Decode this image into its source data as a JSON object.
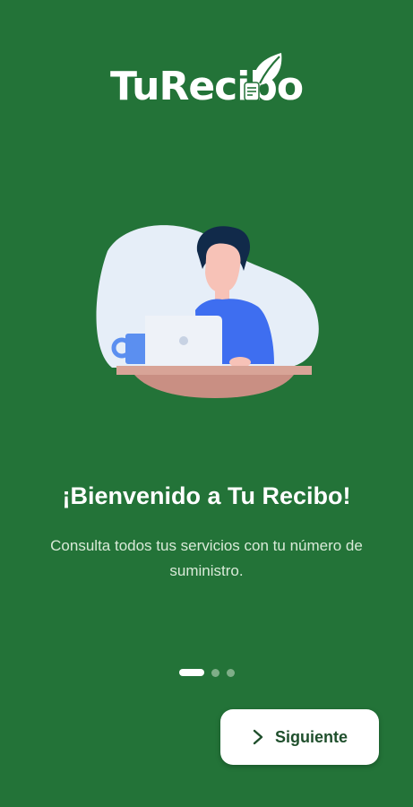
{
  "app": {
    "logo_text": "TuRecibo"
  },
  "onboarding": {
    "title": "¡Bienvenido a Tu Recibo!",
    "subtitle": "Consulta todos tus servicios con tu número de suministro.",
    "page_count": 3,
    "current_page": 1
  },
  "actions": {
    "next_label": "Siguiente",
    "next_icon": "chevron-right-icon"
  },
  "colors": {
    "background": "#237338",
    "accent_white": "#ffffff",
    "button_text": "#1f4f2c",
    "dot_inactive": "#7fae88"
  }
}
